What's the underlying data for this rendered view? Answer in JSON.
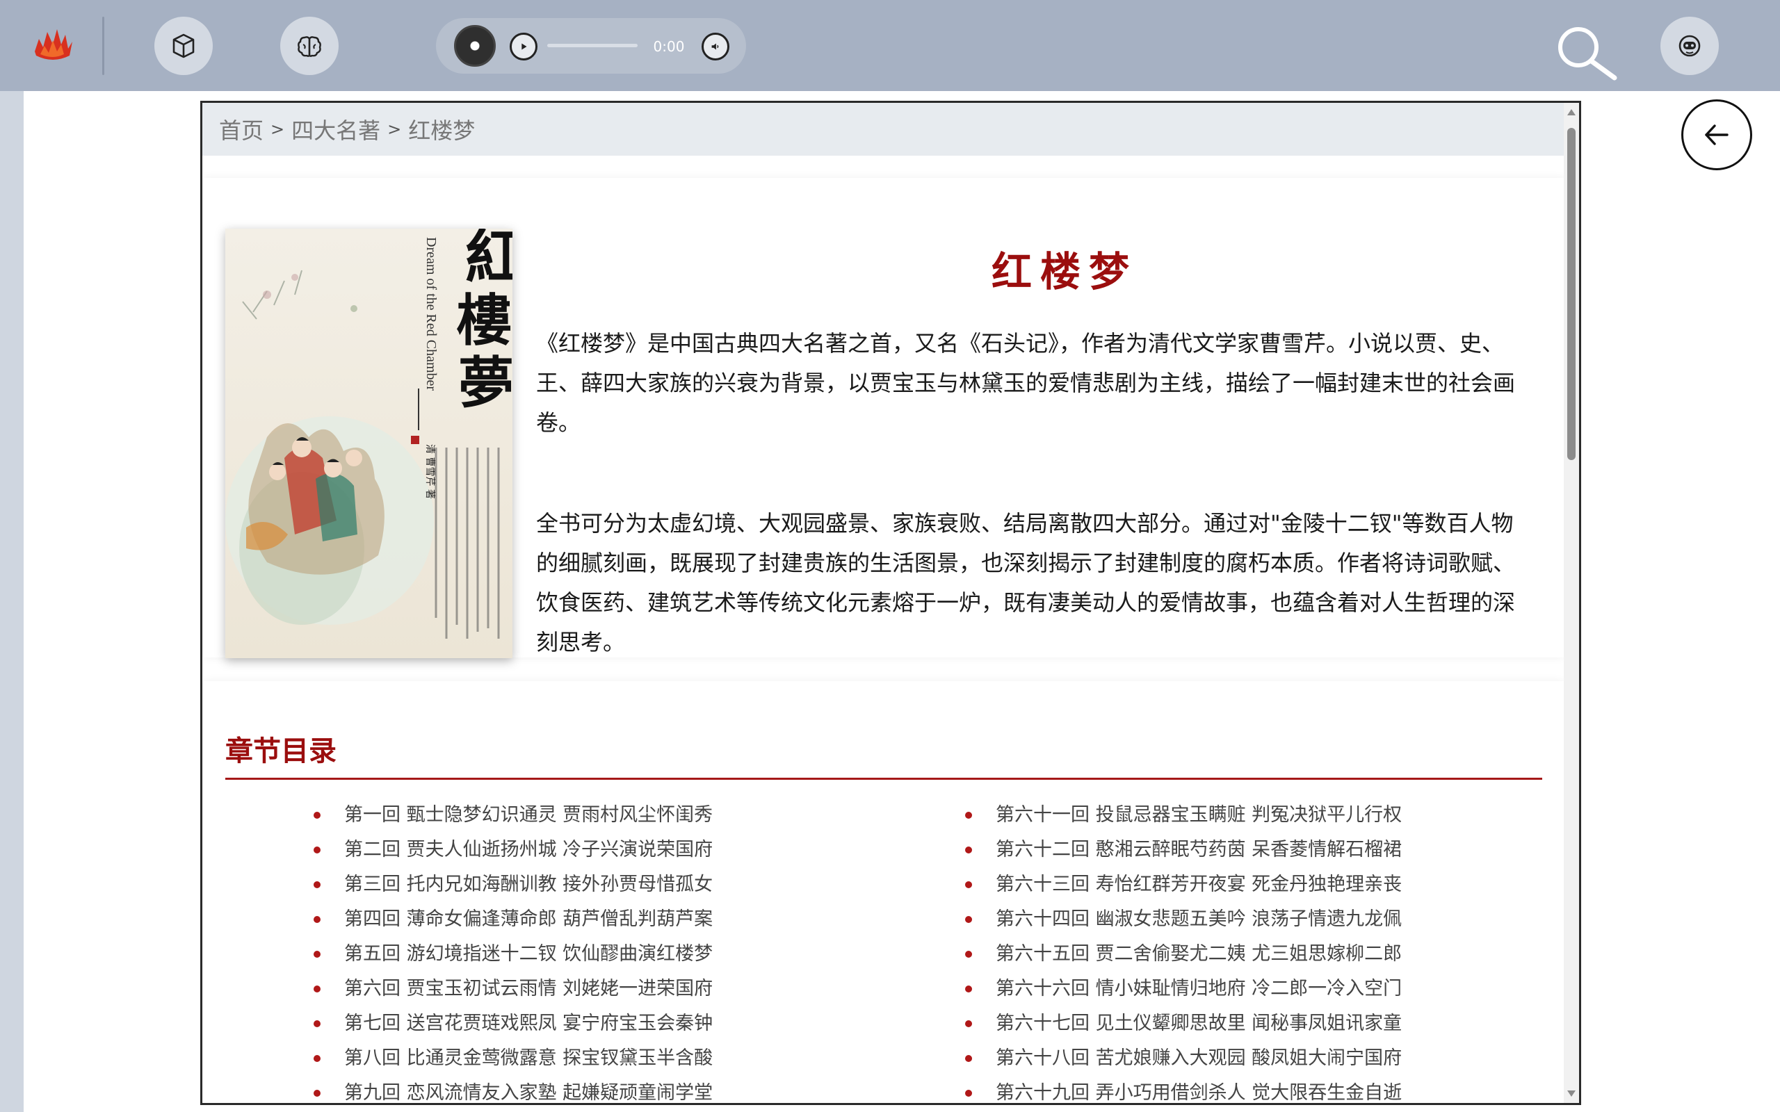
{
  "toolbar": {
    "logo_icon": "flame-logo-icon",
    "buttons": [
      "cube-icon",
      "brain-icon"
    ],
    "player": {
      "time": "0:00",
      "play_icon": "play-icon",
      "volume_icon": "volume-icon"
    },
    "search_icon": "search-icon",
    "assistant_icon": "robot-face-icon"
  },
  "breadcrumb": {
    "items": [
      "首页",
      "四大名著",
      "红楼梦"
    ],
    "separator": ">"
  },
  "book": {
    "title": "红楼梦",
    "cover": {
      "calligraphy": "紅樓夢",
      "english_title": "Dream of the Red Chamber",
      "author_seal": "清 曹雪芹 著"
    },
    "description": [
      "《红楼梦》是中国古典四大名著之首，又名《石头记》，作者为清代文学家曹雪芹。小说以贾、史、王、薛四大家族的兴衰为背景，以贾宝玉与林黛玉的爱情悲剧为主线，描绘了一幅封建末世的社会画卷。",
      "全书可分为太虚幻境、大观园盛景、家族衰败、结局离散四大部分。通过对\"金陵十二钗\"等数百人物的细腻刻画，既展现了封建贵族的生活图景，也深刻揭示了封建制度的腐朽本质。作者将诗词歌赋、饮食医药、建筑艺术等传统文化元素熔于一炉，既有凄美动人的爱情故事，也蕴含着对人生哲理的深刻思考。"
    ]
  },
  "toc": {
    "title": "章节目录",
    "left": [
      "第一回 甄士隐梦幻识通灵 贾雨村风尘怀闺秀",
      "第二回 贾夫人仙逝扬州城 冷子兴演说荣国府",
      "第三回 托内兄如海酬训教 接外孙贾母惜孤女",
      "第四回 薄命女偏逢薄命郎 葫芦僧乱判葫芦案",
      "第五回 游幻境指迷十二钗 饮仙醪曲演红楼梦",
      "第六回 贾宝玉初试云雨情 刘姥姥一进荣国府",
      "第七回 送宫花贾琏戏熙凤 宴宁府宝玉会秦钟",
      "第八回 比通灵金莺微露意 探宝钗黛玉半含酸",
      "第九回 恋风流情友入家塾 起嫌疑顽童闹学堂"
    ],
    "right": [
      "第六十一回 投鼠忌器宝玉瞒赃 判冤决狱平儿行权",
      "第六十二回 憨湘云醉眠芍药茵 呆香菱情解石榴裙",
      "第六十三回 寿怡红群芳开夜宴 死金丹独艳理亲丧",
      "第六十四回 幽淑女悲题五美吟 浪荡子情遗九龙佩",
      "第六十五回 贾二舍偷娶尤二姨 尤三姐思嫁柳二郎",
      "第六十六回 情小妹耻情归地府 冷二郎一冷入空门",
      "第六十七回 见土仪颦卿思故里 闻秘事凤姐讯家童",
      "第六十八回 苦尤娘赚入大观园 酸凤姐大闹宁国府",
      "第六十九回 弄小巧用借剑杀人 觉大限吞生金自逝"
    ]
  },
  "colors": {
    "accent_red": "#9b0e0e",
    "toolbar_bg": "#a6b1c3",
    "breadcrumb_bg": "#e7ebef"
  }
}
